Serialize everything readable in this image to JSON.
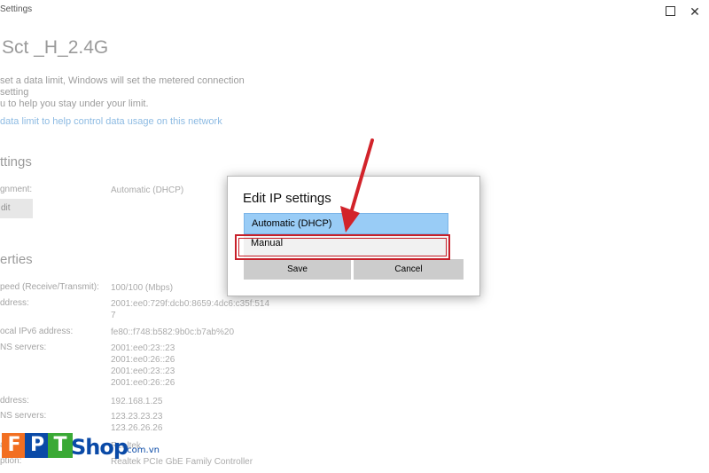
{
  "window": {
    "title": "Settings",
    "close_glyph": "✕"
  },
  "network": {
    "name": "Sct _H_2.4G",
    "description_line1": "set a data limit, Windows will set the metered connection setting",
    "description_line2": "u to help you stay under your limit.",
    "data_limit_link": "data limit to help control data usage on this network"
  },
  "ip_settings": {
    "heading": "ttings",
    "assignment_label": "gnment:",
    "assignment_value": "Automatic (DHCP)",
    "edit_label": "dit"
  },
  "properties": {
    "heading": "erties",
    "rows": [
      {
        "label": "peed (Receive/Transmit):",
        "value": [
          "100/100 (Mbps)"
        ]
      },
      {
        "label": "ddress:",
        "value": [
          "2001:ee0:729f:dcb0:8659:4dc6:c35f:514",
          "7"
        ]
      },
      {
        "label": "ocal IPv6 address:",
        "value": [
          "fe80::f748:b582:9b0c:b7ab%20"
        ]
      },
      {
        "label": "NS servers:",
        "value": [
          "2001:ee0:23::23",
          "2001:ee0:26::26",
          "2001:ee0:23::23",
          "2001:ee0:26::26"
        ]
      },
      {
        "label": "ddress:",
        "value": [
          "192.168.1.25"
        ]
      },
      {
        "label": "NS servers:",
        "value": [
          "123.23.23.23",
          "123.26.26.26"
        ]
      },
      {
        "label": "ac",
        "value": [
          "Realtek"
        ]
      },
      {
        "label": "ption:",
        "value": [
          "Realtek PCIe GbE Family Controller"
        ]
      }
    ]
  },
  "dialog": {
    "title": "Edit IP settings",
    "selected_option": "Automatic (DHCP)",
    "options": [
      "Manual"
    ],
    "save_label": "Save",
    "cancel_label": "Cancel"
  },
  "watermark": {
    "letters": [
      "F",
      "P",
      "T"
    ],
    "shop": "Shop",
    "domain": ".com.vn",
    "colors": {
      "orange": "#f26f21",
      "blue": "#0a4aa7",
      "green": "#3aa935"
    }
  },
  "colors": {
    "highlight": "#c8202a",
    "selection": "#99ccf6",
    "link": "#0067c0"
  }
}
